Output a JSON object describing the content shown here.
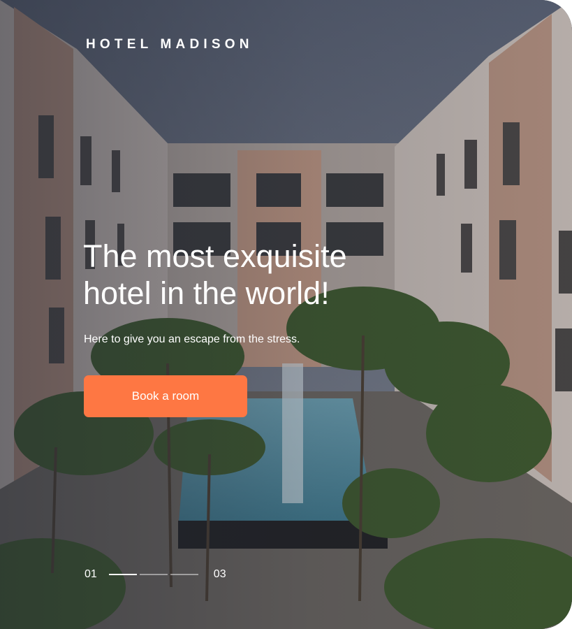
{
  "brand": {
    "name": "HOTEL MADISON"
  },
  "hero": {
    "headline": "The most exquisite hotel in the world!",
    "subtext": "Here to give you an escape from the stress.",
    "cta_label": "Book a room",
    "background_image": "hotel-courtyard-pool"
  },
  "slider": {
    "current": "01",
    "total": "03",
    "active_index": 0,
    "slide_count": 3
  },
  "colors": {
    "accent": "#FE7743",
    "text": "#FFFFFF",
    "overlay": "#232834"
  }
}
